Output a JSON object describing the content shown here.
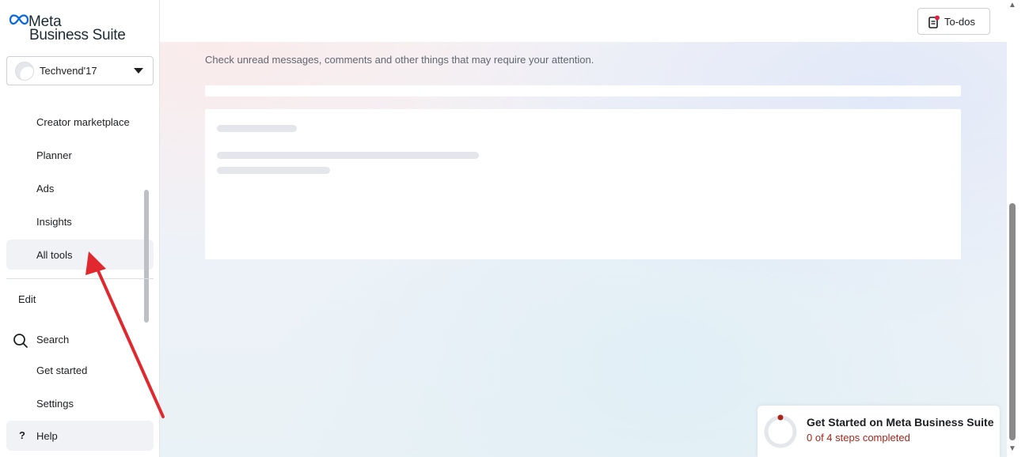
{
  "app": {
    "logo_line1": "Meta",
    "logo_line2": "Business Suite"
  },
  "account": {
    "name": "Techvend'17"
  },
  "sidebar": {
    "items": [
      {
        "label": "Creator marketplace"
      },
      {
        "label": "Planner"
      },
      {
        "label": "Ads"
      },
      {
        "label": "Insights"
      },
      {
        "label": "All tools"
      },
      {
        "label": "Edit"
      },
      {
        "label": "Search"
      },
      {
        "label": "Get started"
      },
      {
        "label": "Settings"
      },
      {
        "label": "Help"
      }
    ]
  },
  "header": {
    "todos_label": "To-dos"
  },
  "main": {
    "subtitle": "Check unread messages, comments and other things that may require your attention."
  },
  "get_started": {
    "title": "Get Started on Meta Business Suite",
    "progress_text": "0 of 4 steps completed",
    "steps_completed": 0,
    "steps_total": 4
  },
  "colors": {
    "annotation_arrow": "#e0282e",
    "progress_text": "#a8251a"
  },
  "icons": {
    "logo": "meta-infinity-icon",
    "todos": "clipboard-notification-icon",
    "search": "search-icon",
    "help": "question-mark-icon",
    "dropdown": "caret-down-icon"
  }
}
